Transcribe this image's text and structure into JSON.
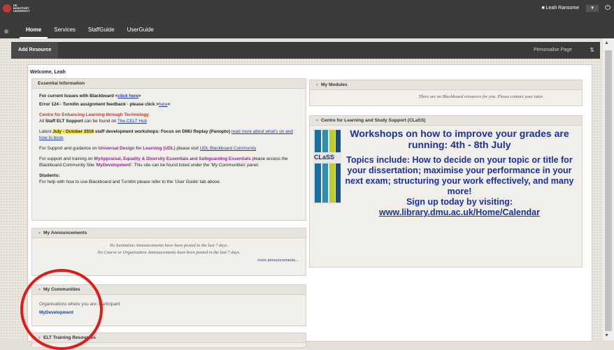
{
  "header": {
    "university_line1": "DE MONTFORT",
    "university_line2": "UNIVERSITY",
    "tabs": [
      "Home",
      "Services",
      "StaffGuide",
      "UserGuide"
    ],
    "user_name": "Leah Ransome"
  },
  "actionbar": {
    "add_resource": "Add Resource",
    "personalise": "Personalise Page"
  },
  "welcome": "Welcome, Leah",
  "essential": {
    "title": "Essential Information",
    "issues_prefix": "For current Issues with Blackboard <",
    "issues_link": "click here",
    "issues_suffix": ">",
    "error124_prefix": "Error 124 - Turnitin assignment feedback - please click >",
    "error124_link": "here",
    "error124_suffix": "<",
    "celt_title": "Centre for Enhancing Learning through Technology",
    "celt_text_prefix": "All ",
    "celt_text_bold": "Staff ELT Support",
    "celt_text_mid": " can be found on ",
    "celt_link": "The CELT Hub",
    "latest_prefix": "Latest ",
    "latest_highlight": "July - October 2016",
    "latest_mid": " staff development workshops: Focus on DMU Replay (Panopto) ",
    "latest_link": "read more about what's on and how to book",
    "latest_suffix": ".",
    "udl_prefix": "For Support and guidance on ",
    "udl_bold": "Universal Design for Learning (UDL)",
    "udl_mid": " please visit ",
    "udl_link": "UDL Blackboard Community",
    "mydev_prefix": "For support and training on ",
    "mydev_bold": "MyAppraisal, Equality & Diversity Essentials and Safeguarding Essentials",
    "mydev_mid": " please access the Blackboard Community Site '",
    "mydev_site": "MyDevelopment",
    "mydev_suffix": "'. This site can be found listed under the 'My Communities' panel.",
    "students_title": "Students:",
    "students_text": "For help with how to use Blackboard and Turnitin please refer to the 'User Guide' tab above."
  },
  "announcements": {
    "title": "My Announcements",
    "line1": "No Institution Announcements have been posted in the last 7 days.",
    "line2": "No Course or Organisation Announcements have been posted in the last 7 days.",
    "more": "more announcements..."
  },
  "communities": {
    "title": "My Communities",
    "text": "Organisations where you are: Participant",
    "link": "MyDevelopment"
  },
  "elt": {
    "title": "ELT Training Resources"
  },
  "modules": {
    "title": "My Modules",
    "text": "There are no Blackboard resources for you. Please contact your tutor."
  },
  "class": {
    "title": "Centre for Learning and Study Support (CLaSS)",
    "logo_text": "CLaSS",
    "headline": "Workshops on how to improve your grades are running: 4th - 8th July",
    "topics": "Topics include: How to decide on your topic or title for your dissertation; maximise your performance in your next exam; structuring your work effectively, and many more!",
    "signup": "Sign up today by visiting:",
    "url": "www.library.dmu.ac.uk/Home/Calendar"
  },
  "colors": {
    "accent_red": "#c0392b",
    "link_blue": "#1a3da6",
    "class_blue": "#1a2fa8",
    "annotation_circle": "#e01b1b"
  },
  "icons": {
    "user": "user-icon",
    "dropdown": "chevron-down-icon",
    "power": "power-icon",
    "sort": "sort-icon",
    "collapse": "collapse-arrow-icon"
  }
}
